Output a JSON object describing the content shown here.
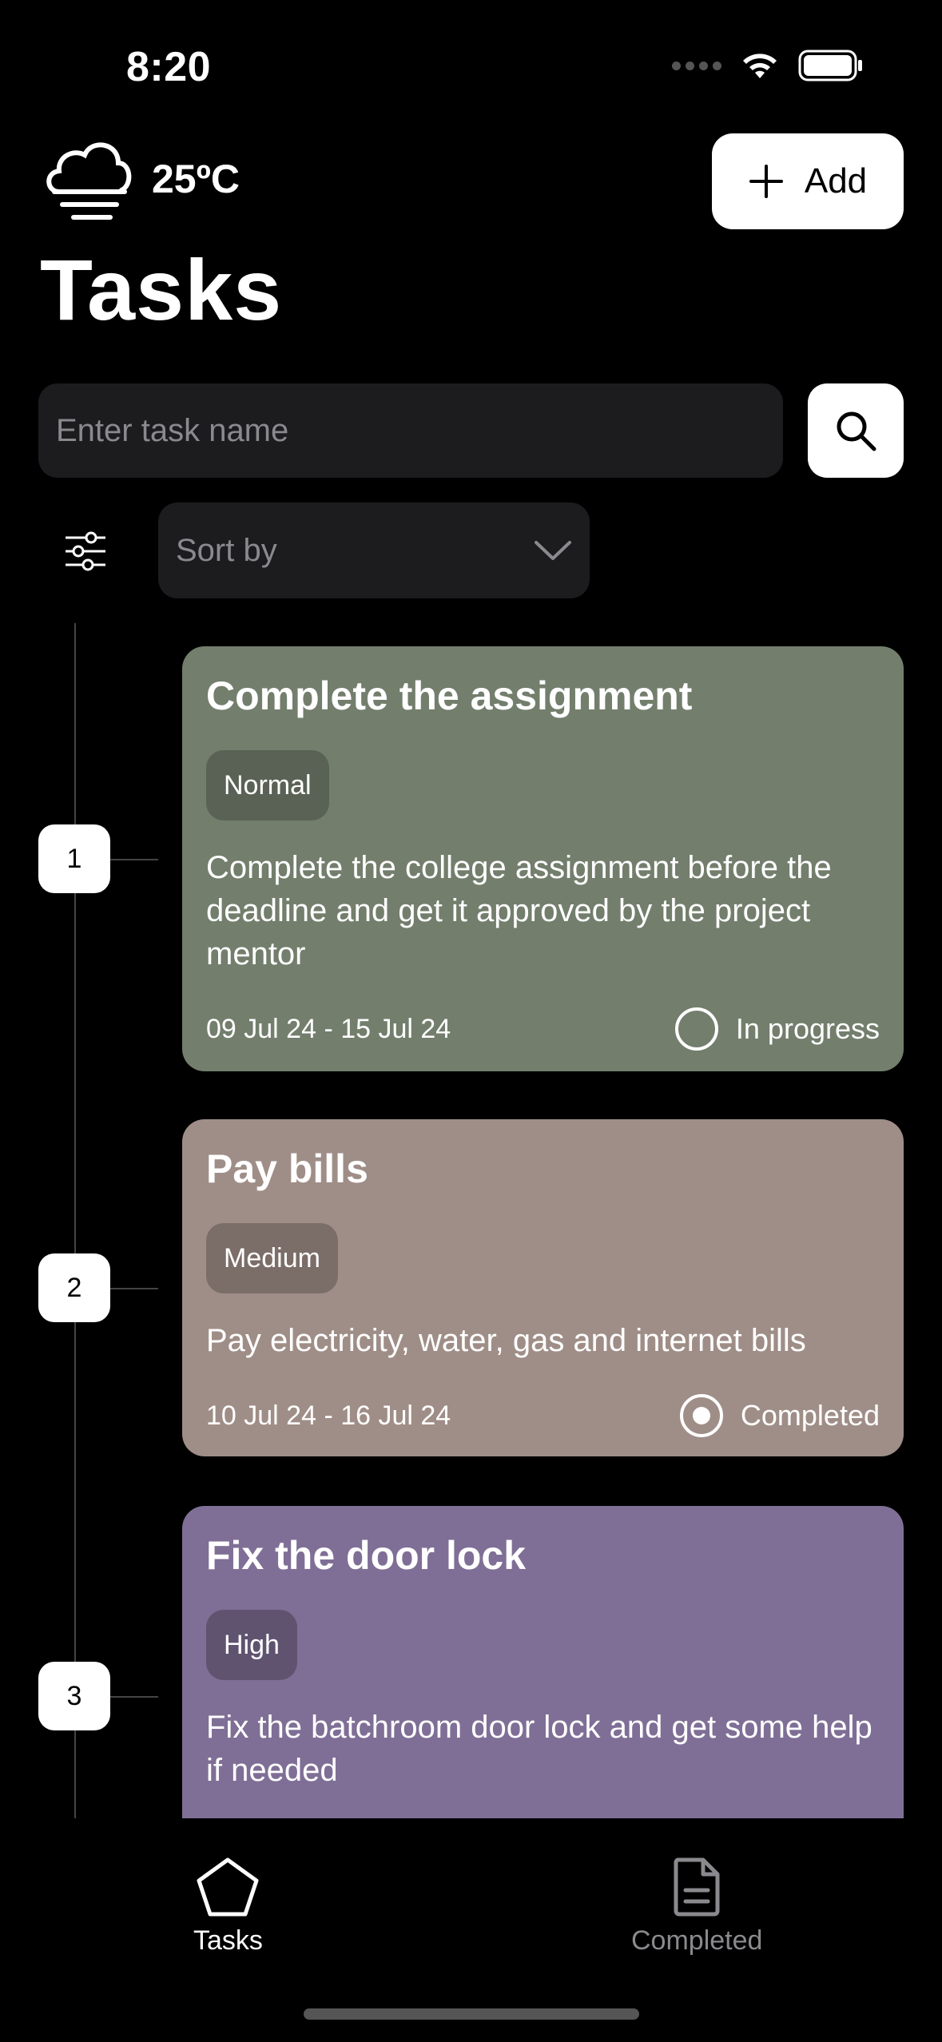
{
  "status_bar": {
    "time": "8:20"
  },
  "header": {
    "weather_icon": "cloud-wind-icon",
    "temperature": "25ºC",
    "add_label": "Add",
    "title": "Tasks"
  },
  "search": {
    "placeholder": "Enter task name"
  },
  "sort": {
    "placeholder": "Sort by"
  },
  "tasks": [
    {
      "index": "1",
      "title": "Complete the assignment",
      "priority": "Normal",
      "description": "Complete the college assignment before the deadline and get it approved by the project mentor",
      "dates": "09 Jul 24 - 15 Jul 24",
      "status": "In progress",
      "completed": false,
      "card_color": "#737e6d",
      "badge_color": "#5a6255"
    },
    {
      "index": "2",
      "title": "Pay bills",
      "priority": "Medium",
      "description": "Pay electricity, water, gas and internet bills",
      "dates": "10 Jul 24 - 16 Jul 24",
      "status": "Completed",
      "completed": true,
      "card_color": "#9f8e87",
      "badge_color": "#7b6d68"
    },
    {
      "index": "3",
      "title": "Fix the door lock",
      "priority": "High",
      "description": "Fix the batchroom door lock and get some help if needed",
      "card_color": "#7f6f96",
      "badge_color": "#5f5370"
    }
  ],
  "nav": {
    "tasks_label": "Tasks",
    "completed_label": "Completed",
    "active_color": "#ffffff",
    "inactive_color": "#8a8a8e"
  }
}
